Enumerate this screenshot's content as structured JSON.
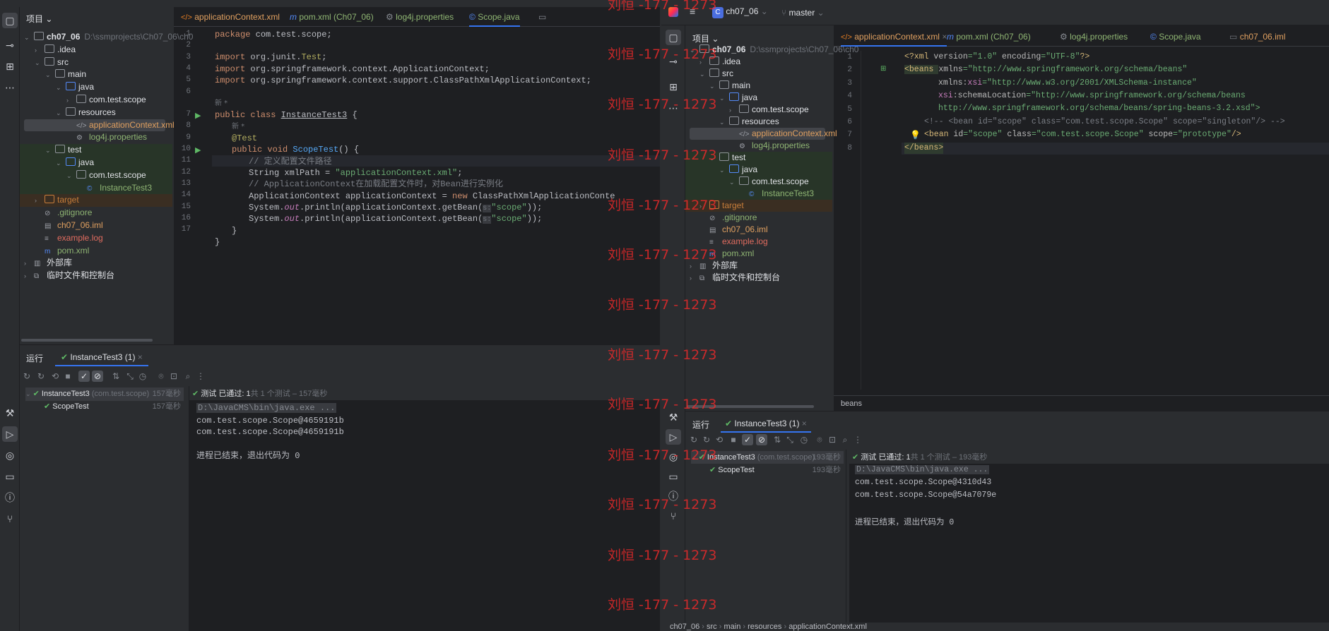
{
  "left": {
    "project_label": "项目",
    "tree": [
      {
        "label": "ch07_06",
        "suffix": "D:\\ssmprojects\\Ch07_06\\ch0"
      },
      {
        "label": ".idea"
      },
      {
        "label": "src"
      },
      {
        "label": "main"
      },
      {
        "label": "java"
      },
      {
        "label": "com.test.scope"
      },
      {
        "label": "resources"
      },
      {
        "label": "applicationContext.xml"
      },
      {
        "label": "log4j.properties"
      },
      {
        "label": "test"
      },
      {
        "label": "java"
      },
      {
        "label": "com.test.scope"
      },
      {
        "label": "InstanceTest3"
      },
      {
        "label": "target"
      },
      {
        "label": ".gitignore"
      },
      {
        "label": "ch07_06.iml"
      },
      {
        "label": "example.log"
      },
      {
        "label": "pom.xml"
      },
      {
        "label": "外部库"
      },
      {
        "label": "临时文件和控制台"
      }
    ],
    "tabs": [
      "applicationContext.xml",
      "pom.xml (Ch07_06)",
      "log4j.properties",
      "Scope.java"
    ],
    "line_numbers": [
      "1",
      "2",
      "3",
      "4",
      "5",
      "6",
      "",
      "7",
      "8",
      "9",
      "10",
      "11",
      "12",
      "13",
      "14",
      "15",
      "16",
      "17"
    ],
    "code": {
      "l1a": "package",
      "l1b": " com.test.scope;",
      "l3a": "import",
      "l3b": " org.junit.",
      "l3c": "Test",
      ";": ";",
      "l4a": "import",
      "l4b": " org.springframework.context.ApplicationContext;",
      "l5a": "import",
      "l5b": " org.springframework.context.support.ClassPathXmlApplicationContext;",
      "hint1": "新 *",
      "l7a": "public class ",
      "l7b": "InstanceTest3",
      " l7c": " {",
      "hint2": "新 *",
      "l8": "@Test",
      "l9a": "public void ",
      "l9b": "ScopeTest",
      "l9c": "() {",
      "l10": "// 定义配置文件路径",
      "l11a": "String xmlPath = ",
      "l11b": "\"applicationContext.xml\"",
      ";2": ";",
      "l12": "// ApplicationContext在加载配置文件时，对Bean进行实例化",
      "l13a": "ApplicationContext applicationContext = ",
      "l13b": "new",
      " l13c": " ClassPathXmlApplicationConte",
      "l14a": "System.",
      "l14b": "out",
      "l14c": ".println(applicationContext.getBean(",
      "l14d": "s:",
      "l14e": "\"scope\"",
      "l14f": "));",
      "l16": "}",
      "l17": "}"
    },
    "run": {
      "tab_run": "运行",
      "tab_name": "InstanceTest3 (1)",
      "tree_root": "InstanceTest3",
      "tree_root_pkg": "(com.test.scope)",
      "tree_root_time": "157毫秒",
      "tree_child": "ScopeTest",
      "tree_child_time": "157毫秒",
      "status_a": "测试 已通过: 1",
      "status_b": "共 1 个测试 – 157毫秒",
      "cmd": "D:\\JavaCMS\\bin\\java.exe ...",
      "out1": "com.test.scope.Scope@4659191b",
      "out2": "com.test.scope.Scope@4659191b",
      "exit": "进程已结束，退出代码为 0"
    }
  },
  "right": {
    "project_name": "ch07_06",
    "branch": "master",
    "project_label": "项目",
    "tree": [
      {
        "label": "ch07_06",
        "suffix": "D:\\ssmprojects\\Ch07_06\\ch0"
      },
      {
        "label": ".idea"
      },
      {
        "label": "src"
      },
      {
        "label": "main"
      },
      {
        "label": "java"
      },
      {
        "label": "com.test.scope"
      },
      {
        "label": "resources"
      },
      {
        "label": "applicationContext.xml"
      },
      {
        "label": "log4j.properties"
      },
      {
        "label": "test"
      },
      {
        "label": "java"
      },
      {
        "label": "com.test.scope"
      },
      {
        "label": "InstanceTest3"
      },
      {
        "label": "target"
      },
      {
        "label": ".gitignore"
      },
      {
        "label": "ch07_06.iml"
      },
      {
        "label": "example.log"
      },
      {
        "label": "pom.xml"
      },
      {
        "label": "外部库"
      },
      {
        "label": "临时文件和控制台"
      }
    ],
    "tabs": [
      "applicationContext.xml",
      "pom.xml (Ch07_06)",
      "log4j.properties",
      "Scope.java",
      "ch07_06.iml"
    ],
    "line_numbers": [
      "1",
      "2",
      "3",
      "4",
      "5",
      "6",
      "7",
      "8"
    ],
    "xml": {
      "x1a": "<?xml ",
      "x1b": "version",
      "x1c": "=\"1.0\" ",
      "x1d": "encoding",
      "x1e": "=\"UTF-8\"",
      "x1f": "?>",
      "x2a": "<beans ",
      "x2b": "xmlns",
      "x2c": "=\"http://www.springframework.org/schema/beans\"",
      "x3a": "xmlns:",
      "x3b": "xsi",
      "x3c": "=\"http://www.w3.org/2001/XMLSchema-instance\"",
      "x4a": "xsi",
      "x4b": ":schemaLocation",
      "x4c": "=\"http://www.springframework.org/schema/beans",
      "x5": "http://www.springframework.org/schema/beans/spring-beans-3.2.xsd\">",
      "x6": "<!-- <bean id=\"scope\" class=\"com.test.scope.Scope\" scope=\"singleton\"/> -->",
      "x7a": "<bean ",
      "x7b": "id",
      "x7c": "=\"scope\" ",
      "x7d": "class",
      "x7e": "=\"com.test.scope.Scope\" ",
      "x7f": "scope",
      "x7g": "=\"prototype\"",
      "x7h": "/>",
      "x8": "</beans>"
    },
    "breadcrumb_editor": "beans",
    "run": {
      "tab_run": "运行",
      "tab_name": "InstanceTest3 (1)",
      "tree_root": "InstanceTest3",
      "tree_root_pkg": "(com.test.scope)",
      "tree_root_time": "193毫秒",
      "tree_child": "ScopeTest",
      "tree_child_time": "193毫秒",
      "status_a": "测试 已通过: 1",
      "status_b": "共 1 个测试 – 193毫秒",
      "cmd": "D:\\JavaCMS\\bin\\java.exe ...",
      "out1": "com.test.scope.Scope@4310d43",
      "out2": "com.test.scope.Scope@54a7079e",
      "exit": "进程已结束，退出代码为 0"
    },
    "statusbar": [
      "ch07_06",
      "src",
      "main",
      "resources",
      "applicationContext.xml"
    ]
  },
  "watermark": "刘恒 -177 - 1273",
  "colors": {
    "accent": "#3574f0",
    "watermark": "#ff2a2a",
    "pass": "#5fb865"
  }
}
